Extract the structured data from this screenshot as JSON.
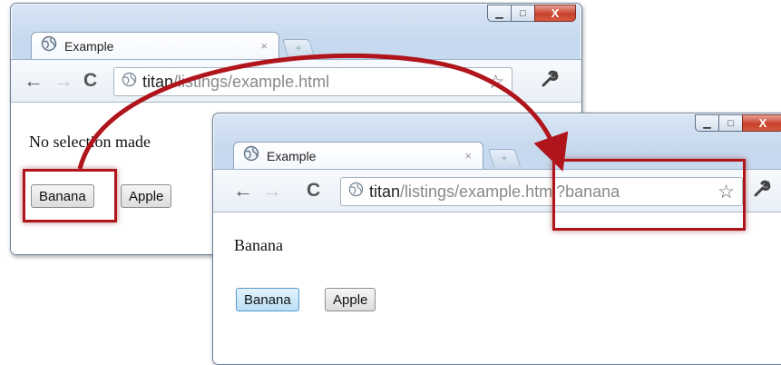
{
  "colors": {
    "highlight": "#b0151c",
    "window_frame": "#c9dbef",
    "close_button": "#c8412c",
    "url_path": "#888888",
    "selected_button": "#b9dff7"
  },
  "window_controls": {
    "minimize_glyph": "▁",
    "maximize_glyph": "□",
    "close_glyph": "X"
  },
  "window_back": {
    "tab_title": "Example",
    "tab_close": "×",
    "new_tab_glyph": "+",
    "url_host": "titan",
    "url_path": "/listings/example.html",
    "status_text": "No selection made",
    "buttons": {
      "banana": "Banana",
      "apple": "Apple"
    }
  },
  "window_front": {
    "tab_title": "Example",
    "tab_close": "×",
    "new_tab_glyph": "+",
    "url_host": "titan",
    "url_path": "/listings/example.html?banana",
    "status_text": "Banana",
    "buttons": {
      "banana": "Banana",
      "apple": "Apple"
    }
  },
  "icons": {
    "back": "back-arrow-icon",
    "forward": "forward-arrow-icon",
    "reload": "reload-icon",
    "globe": "globe-icon",
    "star": "star-icon",
    "wrench": "wrench-icon"
  },
  "glyphs": {
    "back": "←",
    "forward": "→",
    "reload": "C",
    "star": "☆",
    "wrench": "🔧"
  }
}
